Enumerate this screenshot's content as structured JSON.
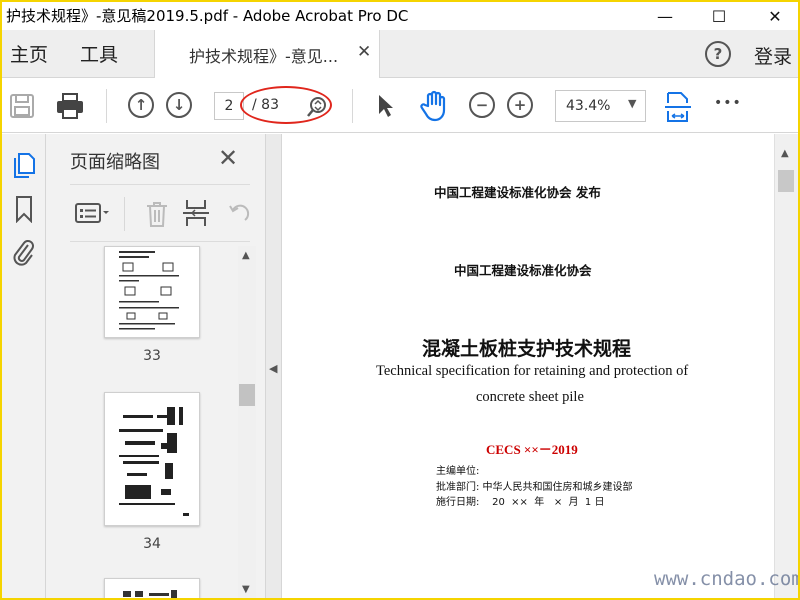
{
  "window": {
    "title": "护技术规程》-意见稿2019.5.pdf - Adobe Acrobat Pro DC",
    "minimize": "—",
    "maximize": "☐",
    "close": "✕"
  },
  "menubar": {
    "home": "主页",
    "tools": "工具",
    "doc_tab_label": "护技术规程》-意见...",
    "doc_tab_close": "✕",
    "help": "?",
    "login": "登录"
  },
  "toolbar": {
    "current_page": "2",
    "total_pages": "/ 83",
    "zoom": "43.4%",
    "zoom_arrow": "▼",
    "more": "•••"
  },
  "panel": {
    "title": "页面缩略图",
    "close": "✕",
    "thumbnails": [
      {
        "page": "33"
      },
      {
        "page": "34"
      }
    ]
  },
  "document": {
    "publisher": "中国工程建设标准化协会    发布",
    "org": "中国工程建设标准化协会",
    "title_cn": "混凝土板桩支护技术规程",
    "title_en_1": "Technical specification for retaining and protection of",
    "title_en_2": "concrete sheet pile",
    "code": "CECS ××－2019",
    "editor_label": "主编单位:",
    "approval": "批准部门: 中华人民共和国住房和城乡建设部",
    "date": "施行日期:    20  ××  年   ×  月  1 日"
  },
  "watermark": "www.cndao.com",
  "colors": {
    "border": "#f5d400",
    "accent": "#1473e6",
    "red": "#e0261c",
    "code_red": "#cc0000"
  }
}
